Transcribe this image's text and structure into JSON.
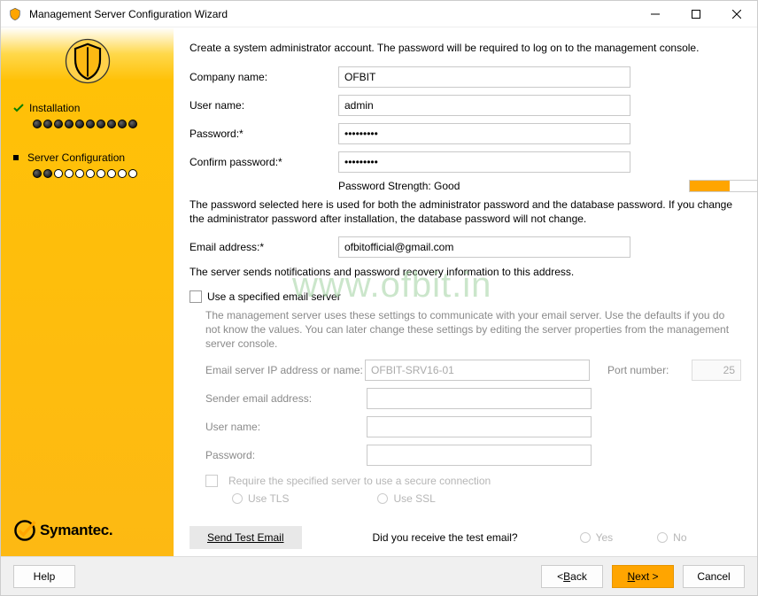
{
  "window": {
    "title": "Management Server Configuration Wizard"
  },
  "sidebar": {
    "steps": [
      {
        "label": "Installation"
      },
      {
        "label": "Server Configuration"
      }
    ],
    "brand": "Symantec."
  },
  "main": {
    "intro": "Create a system administrator account. The password will be required to log on to the management console.",
    "labels": {
      "company": "Company name:",
      "username": "User name:",
      "password": "Password:*",
      "confirm": "Confirm password:*",
      "strength": "Password Strength: Good",
      "email": "Email address:*"
    },
    "values": {
      "company": "OFBIT",
      "username": "admin",
      "password": "•••••••••",
      "confirm": "•••••••••",
      "email": "ofbitofficial@gmail.com"
    },
    "note_password": "The password selected here is used for both the administrator password and the database password. If you change the administrator password after installation, the database password will not change.",
    "note_email": "The server sends notifications and password recovery information to this address.",
    "checkbox_specified": "Use a specified email server",
    "email_settings": {
      "intro": "The management server uses these settings to communicate with your email server.  Use the defaults if you do not know the values. You can later change these settings by editing the server properties from the management server console.",
      "labels": {
        "server": "Email server IP address or name:",
        "port": "Port number:",
        "sender": "Sender email address:",
        "euser": "User name:",
        "epass": "Password:"
      },
      "values": {
        "server": "OFBIT-SRV16-01",
        "port": "25"
      },
      "secure": "Require the specified server to use a secure connection",
      "tls": "Use TLS",
      "ssl": "Use SSL"
    },
    "test": {
      "button": "Send Test Email",
      "question": "Did you receive the test email?",
      "yes": "Yes",
      "no": "No"
    }
  },
  "footer": {
    "help": "Help",
    "back": "< Back",
    "next": "Next >",
    "cancel": "Cancel"
  },
  "watermark": "www.ofbit.in"
}
